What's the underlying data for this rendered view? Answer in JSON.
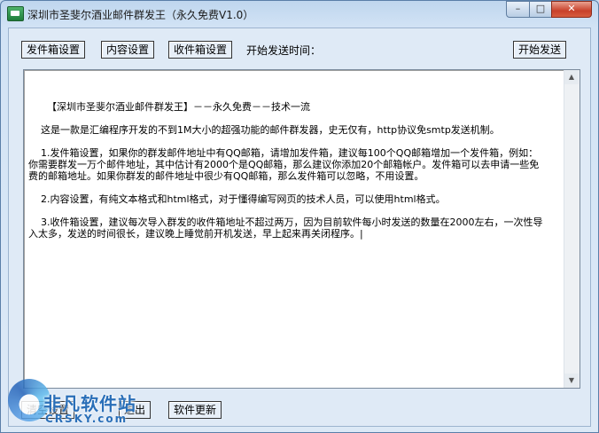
{
  "window": {
    "title": "深圳市圣斐尔酒业邮件群发王（永久免费V1.0）",
    "min_glyph": "–",
    "max_glyph": "□",
    "close_glyph": "✕"
  },
  "toolbar": {
    "sender_btn": "发件箱设置",
    "content_btn": "内容设置",
    "recipient_btn": "收件箱设置",
    "start_time_label": "开始发送时间：",
    "start_btn": "开始发送"
  },
  "content": {
    "text": "【深圳市圣斐尔酒业邮件群发王】－－永久免费－－技术一流\n\n    这是一款是汇编程序开发的不到1M大小的超强功能的邮件群发器，史无仅有，http协议免smtp发送机制。\n\n    1.发件箱设置，如果你的群发邮件地址中有QQ邮箱，请增加发件箱，建议每100个QQ邮箱增加一个发件箱，例如：你需要群发一万个邮件地址，其中估计有2000个是QQ邮箱，那么建议你添加20个邮箱帐户。发件箱可以去申请一些免费的邮箱地址。如果你群发的邮件地址中很少有QQ邮箱，那么发件箱可以忽略，不用设置。\n\n    2.内容设置，有纯文本格式和html格式，对于懂得编写网页的技术人员，可以使用html格式。\n\n    3.收件箱设置，建议每次导入群发的收件箱地址不超过两万，因为目前软件每小时发送的数量在2000左右，一次性导入太多，发送的时间很长，建议晚上睡觉前开机发送，早上起来再关闭程序。|"
  },
  "bottom": {
    "clear_btn": "清空设置",
    "exit_btn": "退出",
    "update_btn": "软件更新"
  },
  "watermark": {
    "text": "非凡软件站",
    "sub": "CRSKY.com"
  }
}
